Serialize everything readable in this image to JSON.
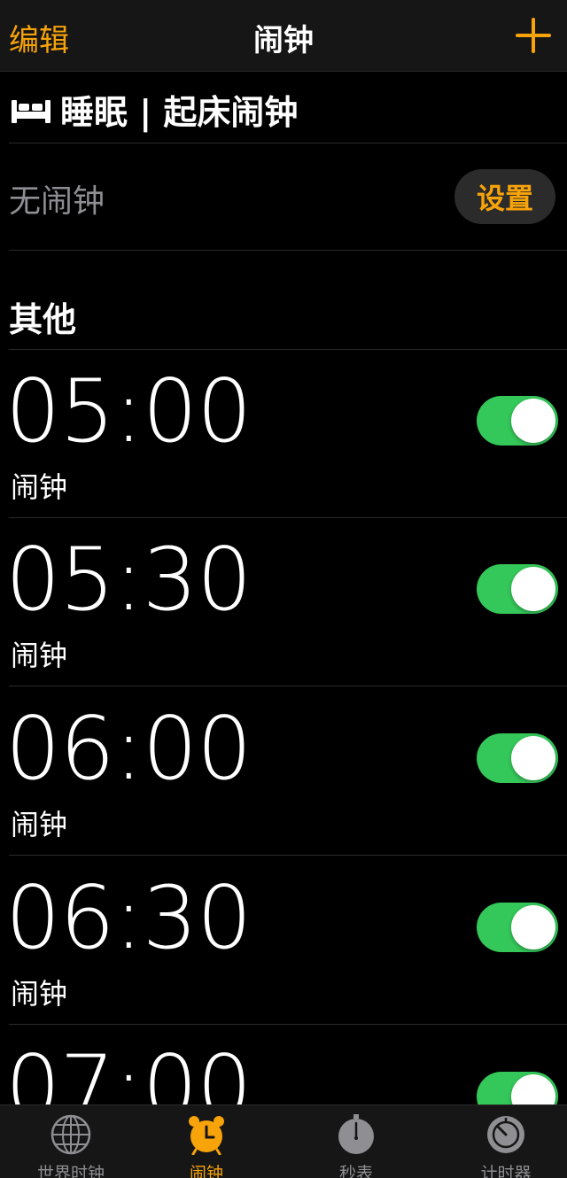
{
  "navbar": {
    "edit_label": "编辑",
    "title": "闹钟"
  },
  "sleep": {
    "title": "睡眠 | 起床闹钟",
    "no_alarm": "无闹钟",
    "setup_label": "设置"
  },
  "other": {
    "header": "其他"
  },
  "alarms": [
    {
      "time": "05:00",
      "label": "闹钟",
      "enabled": true
    },
    {
      "time": "05:30",
      "label": "闹钟",
      "enabled": true
    },
    {
      "time": "06:00",
      "label": "闹钟",
      "enabled": true
    },
    {
      "time": "06:30",
      "label": "闹钟",
      "enabled": true
    },
    {
      "time": "07:00",
      "label": "",
      "enabled": true
    }
  ],
  "tabs": [
    {
      "label": "世界时钟",
      "icon": "globe-icon"
    },
    {
      "label": "闹钟",
      "icon": "alarm-clock-icon",
      "active": true
    },
    {
      "label": "秒表",
      "icon": "stopwatch-icon"
    },
    {
      "label": "计时器",
      "icon": "timer-icon"
    }
  ],
  "colors": {
    "accent": "#f7a30a",
    "toggle_on": "#34c759",
    "background": "#000000",
    "secondary_text": "#8e8e93"
  }
}
